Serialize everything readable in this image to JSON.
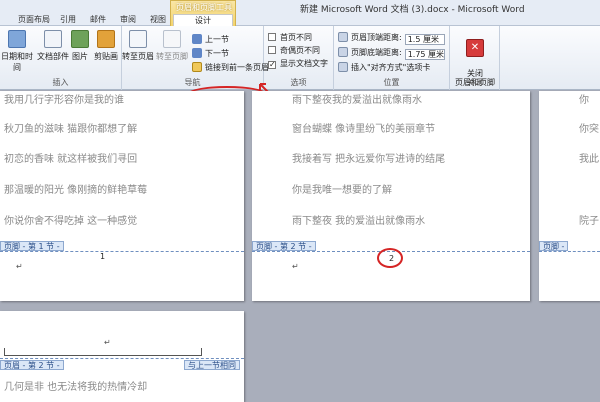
{
  "window": {
    "title": "新建 Microsoft Word 文档 (3).docx - Microsoft Word"
  },
  "tabs": {
    "items": [
      {
        "label": "页面布局"
      },
      {
        "label": "引用"
      },
      {
        "label": "邮件"
      },
      {
        "label": "审阅"
      },
      {
        "label": "视图"
      }
    ],
    "context_group": "页眉和页脚工具",
    "active": "设计"
  },
  "ribbon": {
    "insert": {
      "label": "插入",
      "date_time": "日期和时间",
      "doc_parts": "文档部件",
      "picture": "图片",
      "clipart": "剪贴画"
    },
    "nav": {
      "label": "导航",
      "goto_header": "转至页眉",
      "goto_footer": "转至页脚",
      "prev": "上一节",
      "next": "下一节",
      "link_prev": "链接到前一条页眉"
    },
    "options": {
      "label": "选项",
      "diff_first": {
        "label": "首页不同",
        "checked": false
      },
      "diff_odd_even": {
        "label": "奇偶页不同",
        "checked": false
      },
      "show_text": {
        "label": "显示文档文字",
        "checked": true
      }
    },
    "position": {
      "label": "位置",
      "header_top": {
        "label": "页眉顶端距离:",
        "value": "1.5 厘米"
      },
      "footer_bottom": {
        "label": "页脚底端距离:",
        "value": "1.75 厘米"
      },
      "align_tab": "插入\"对齐方式\"选项卡"
    },
    "close": {
      "label": "关闭",
      "button": "关闭\n页眉和页脚"
    }
  },
  "pages": {
    "page1": {
      "lines": [
        "我用几行字形容你是我的谁",
        "秋刀鱼的滋味  猫跟你都想了解",
        "初恋的香味  就这样被我们寻回",
        "那温暖的阳光  像刚摘的鲜艳草莓",
        "你说你舍不得吃掉  这一种感觉"
      ],
      "footer_tag": "页脚 - 第 1 节 -",
      "page_number": "1"
    },
    "page2": {
      "lines": [
        "雨下整夜我的爱溢出就像雨水",
        "窗台蝴蝶  像诗里纷飞的美丽章节",
        "我接着写  把永远爱你写进诗的结尾",
        "你是我唯一想要的了解",
        "雨下整夜  我的爱溢出就像雨水"
      ],
      "footer_tag": "页脚 - 第 2 节 -",
      "page_number": "2"
    },
    "page3": {
      "lines": [
        "你",
        "你突",
        "我此",
        "院子"
      ],
      "footer_tag": "页脚 -"
    },
    "page4": {
      "header_tag": "页眉 - 第 2 节 -",
      "same_as_prev": "与上一节相同",
      "line": "几何是非  也无法将我的热情冷却"
    }
  }
}
